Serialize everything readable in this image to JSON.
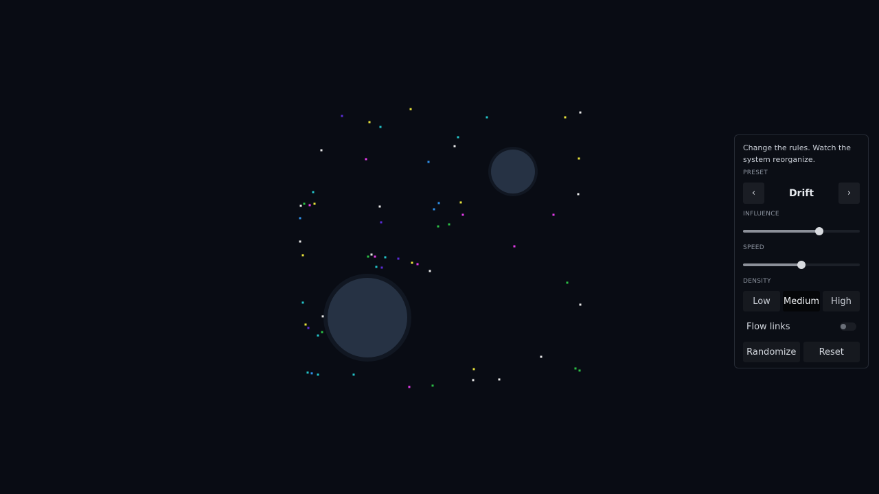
{
  "colors": {
    "background": "#090c14",
    "attractor_fill": "#263244",
    "attractor_ring": "#141a25",
    "panel_bg": "#0b0e15",
    "panel_border": "#262b35",
    "particle_palette": [
      "#e8e23a",
      "#22c3c9",
      "#e23ae8",
      "#5a2bd8",
      "#2bbf45",
      "#e8e8e8",
      "#2f8fe8"
    ]
  },
  "panel": {
    "intro": "Change the rules. Watch the system reorganize.",
    "preset": {
      "label": "PRESET",
      "value": "Drift",
      "prev_icon": "chevron-left-icon",
      "next_icon": "chevron-right-icon",
      "prev_glyph": "‹",
      "next_glyph": "›"
    },
    "influence": {
      "label": "INFLUENCE",
      "value": 0.65
    },
    "speed": {
      "label": "SPEED",
      "value": 0.5
    },
    "density": {
      "label": "DENSITY",
      "options": [
        "Low",
        "Medium",
        "High"
      ],
      "selected": "Medium"
    },
    "flow_links": {
      "label": "Flow links",
      "enabled": false
    },
    "actions": {
      "randomize": "Randomize",
      "reset": "Reset"
    }
  }
}
